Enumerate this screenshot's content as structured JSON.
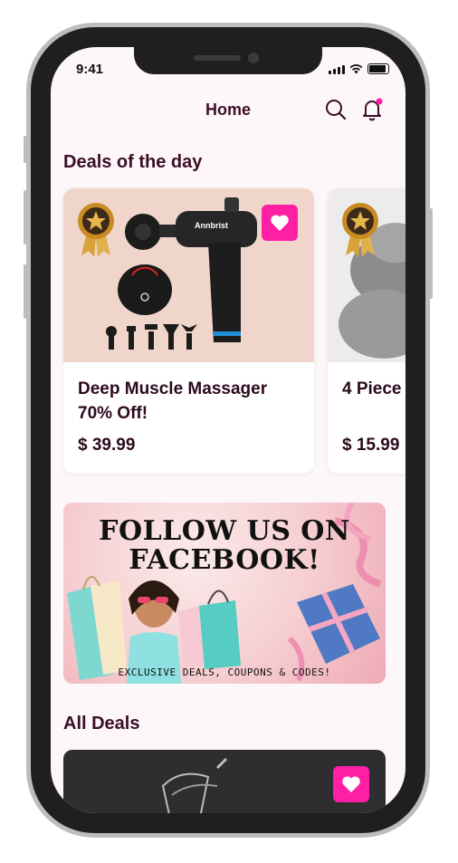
{
  "status_bar": {
    "time": "9:41"
  },
  "header": {
    "title": "Home"
  },
  "sections": {
    "deals_of_the_day": "Deals of the day",
    "all_deals": "All Deals"
  },
  "deals": [
    {
      "title": "Deep Muscle Massager\n70% Off!",
      "price": "$ 39.99",
      "product_brand": "Annbrist"
    },
    {
      "title": "4 Piece",
      "price": "$ 15.99"
    }
  ],
  "banner": {
    "title": "FOLLOW US ON\nFACEBOOK!",
    "subtitle": "EXCLUSIVE DEALS, COUPONS & CODES!"
  },
  "colors": {
    "accent": "#ff1fa5",
    "text_dark": "#3a0f26",
    "card_image_bg": "#f0d5cb"
  },
  "icons": [
    "search-icon",
    "bell-icon",
    "heart-icon",
    "award-badge-icon"
  ]
}
